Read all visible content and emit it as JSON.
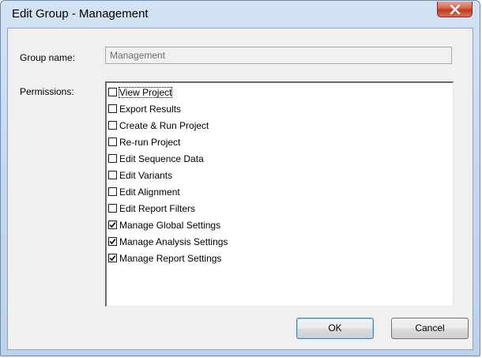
{
  "window": {
    "title": "Edit Group - Management",
    "close_symbol": "x"
  },
  "form": {
    "group_name_label": "Group name:",
    "group_name_value": "Management",
    "permissions_label": "Permissions:"
  },
  "permissions": [
    {
      "label": "View Project",
      "checked": false
    },
    {
      "label": "Export Results",
      "checked": false
    },
    {
      "label": "Create & Run Project",
      "checked": false
    },
    {
      "label": "Re-run Project",
      "checked": false
    },
    {
      "label": "Edit Sequence Data",
      "checked": false
    },
    {
      "label": "Edit Variants",
      "checked": false
    },
    {
      "label": "Edit Alignment",
      "checked": false
    },
    {
      "label": "Edit Report Filters",
      "checked": false
    },
    {
      "label": "Manage Global Settings",
      "checked": true
    },
    {
      "label": "Manage Analysis Settings",
      "checked": true
    },
    {
      "label": "Manage Report Settings",
      "checked": true
    }
  ],
  "buttons": {
    "ok_label": "OK",
    "cancel_label": "Cancel"
  }
}
